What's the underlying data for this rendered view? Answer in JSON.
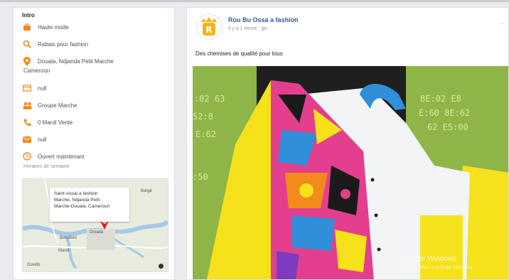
{
  "intro": {
    "title": "Intro",
    "rows": [
      {
        "icon": "briefcase-icon",
        "text": "Haute mode"
      },
      {
        "icon": "search-icon",
        "text": "Rabais pour fashion"
      },
      {
        "icon": "location-pin-icon",
        "text": "Douala, Ndjanda Petit Marche",
        "text2": "Cameroun"
      },
      {
        "icon": "website-icon",
        "text": "null"
      },
      {
        "icon": "group-icon",
        "text": "Groupe Marche"
      },
      {
        "icon": "phone-icon",
        "text": "0 Mardi Vente"
      },
      {
        "icon": "email-icon",
        "text": "null"
      },
      {
        "icon": "clock-icon",
        "text": "Ouvert maintenant",
        "text2": "Horaires de semaine"
      }
    ]
  },
  "map": {
    "popup_line1": "Saint-sissai a fashion",
    "popup_line2": "Marche, Ndjanda Petit",
    "popup_line3": "Marche-Douala, Cameroun",
    "label_top": "Barge",
    "label_city": "Douala",
    "label_zone": "Bonaberi",
    "label_bottom": "Mardi",
    "label_gov": "Govillo"
  },
  "post": {
    "page_name": "Rou Bu Ossa a fashion",
    "meta": "Il y a 1 heure · ge",
    "text": "Des chemises de qualité pour tous",
    "more": "...",
    "watermark1": "Activate Windows",
    "watermark2": "Go to Settings to activate Windows."
  },
  "colors": {
    "accent_orange": "#f28a1c",
    "link_blue": "#365899",
    "shirt_yellow": "#f5e21a",
    "pin_red": "#e01b24"
  }
}
